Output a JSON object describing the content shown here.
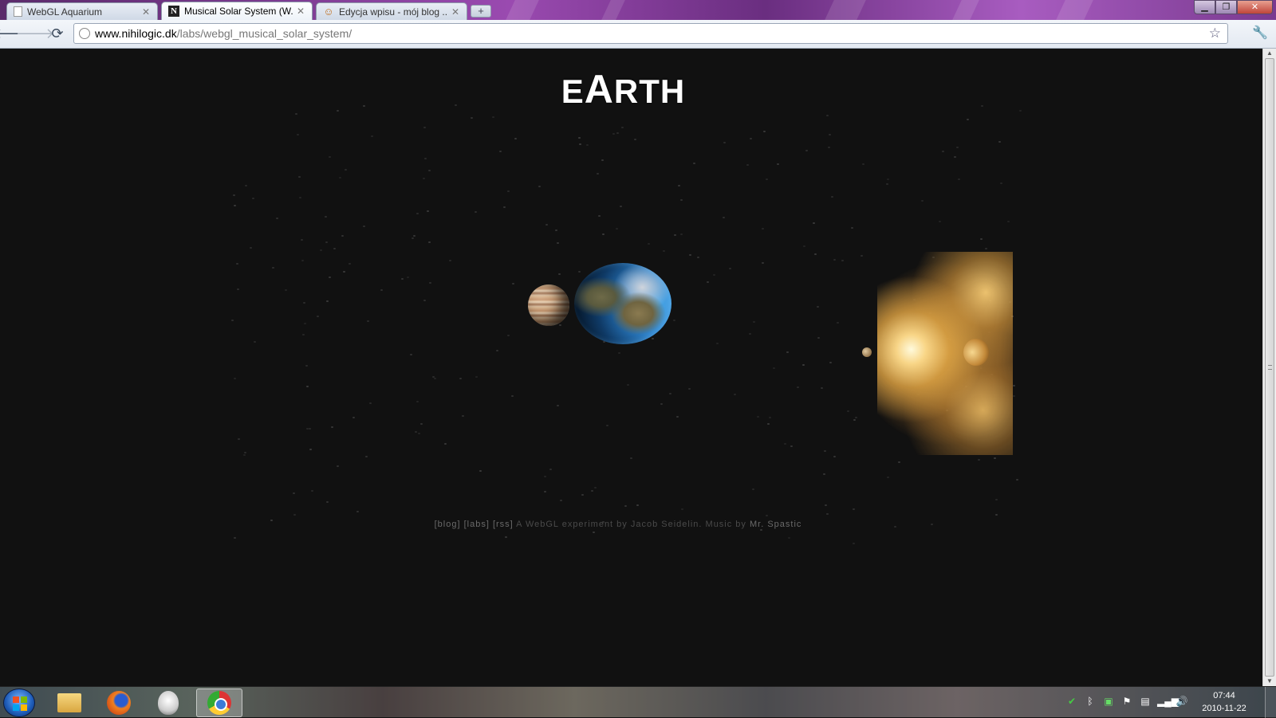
{
  "browser": {
    "tabs": [
      {
        "label": "WebGL Aquarium",
        "icon": "page-icon",
        "active": false
      },
      {
        "label": "Musical Solar System (W...",
        "icon": "nihilogic-icon",
        "active": true
      },
      {
        "label": "Edycja wpisu - mój blog ...",
        "icon": "wordpress-icon",
        "active": false
      }
    ],
    "new_tab": "+",
    "url_host": "www.nihilogic.dk",
    "url_path": "/labs/webgl_musical_solar_system/"
  },
  "page": {
    "title_first": "E",
    "title_big": "A",
    "title_rest": "RTH",
    "footer": {
      "blog": "[blog]",
      "labs": "[labs]",
      "rss": "[rss]",
      "text1": "A WebGL experiment by",
      "author": "Jacob Seidelin.",
      "text2": "Music by",
      "musician": "Mr. Spastic"
    }
  },
  "taskbar": {
    "clock_time": "07:44",
    "clock_date": "2010-11-22"
  },
  "colors": {
    "page_bg": "#111111",
    "title": "#ffffff"
  }
}
